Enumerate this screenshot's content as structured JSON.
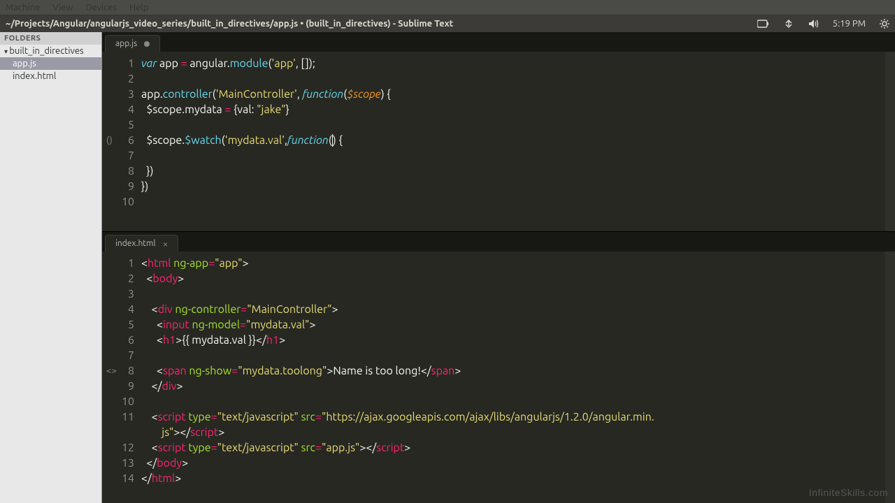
{
  "os_menu": {
    "items": [
      "Machine",
      "View",
      "Devices",
      "Help"
    ]
  },
  "panel": {
    "title": "~/Projects/Angular/angularjs_video_series/built_in_directives/app.js • (built_in_directives) - Sublime Text",
    "time": "5:19 PM"
  },
  "sidebar": {
    "header": "FOLDERS",
    "root": "built_in_directives",
    "files": [
      "app.js",
      "index.html"
    ],
    "selected": "app.js"
  },
  "tabs_top": {
    "label": "app.js",
    "dirty": true
  },
  "tabs_bottom": {
    "label": "index.html",
    "dirty": false
  },
  "code_top": {
    "lines": [
      {
        "n": 1,
        "tokens": [
          [
            "kw2",
            "var"
          ],
          [
            "punc",
            " "
          ],
          [
            "punc",
            "app "
          ],
          [
            "op",
            "="
          ],
          [
            "punc",
            " angular."
          ],
          [
            "fncall",
            "module"
          ],
          [
            "punc",
            "("
          ],
          [
            "str",
            "'app'"
          ],
          [
            "punc",
            ", []);"
          ]
        ]
      },
      {
        "n": 2,
        "tokens": []
      },
      {
        "n": 3,
        "tokens": [
          [
            "punc",
            "app."
          ],
          [
            "fncall",
            "controller"
          ],
          [
            "punc",
            "("
          ],
          [
            "str",
            "'MainController'"
          ],
          [
            "punc",
            ", "
          ],
          [
            "kw2",
            "function"
          ],
          [
            "punc",
            "("
          ],
          [
            "param",
            "$scope"
          ],
          [
            "punc",
            ") {"
          ]
        ]
      },
      {
        "n": 4,
        "tokens": [
          [
            "punc",
            "  $scope.mydata "
          ],
          [
            "op",
            "="
          ],
          [
            "punc",
            " {val: "
          ],
          [
            "str",
            "\"jake\""
          ],
          [
            "punc",
            "}"
          ]
        ]
      },
      {
        "n": 5,
        "tokens": []
      },
      {
        "n": 6,
        "mark": "()",
        "tokens": [
          [
            "punc",
            "  $scope."
          ],
          [
            "fncall",
            "$watch"
          ],
          [
            "punc",
            "("
          ],
          [
            "str",
            "'mydata.val'"
          ],
          [
            "punc",
            ","
          ],
          [
            "kw2",
            "function"
          ],
          [
            "punc",
            "(|) {"
          ]
        ]
      },
      {
        "n": 7,
        "tokens": []
      },
      {
        "n": 8,
        "tokens": [
          [
            "punc",
            "  })"
          ]
        ]
      },
      {
        "n": 9,
        "tokens": [
          [
            "punc",
            "})"
          ]
        ]
      },
      {
        "n": 10,
        "tokens": []
      }
    ]
  },
  "code_bottom": {
    "lines": [
      {
        "n": 1,
        "tokens": [
          [
            "lt",
            "<"
          ],
          [
            "tag",
            "html "
          ],
          [
            "attr",
            "ng-app"
          ],
          [
            "op",
            "="
          ],
          [
            "str",
            "\"app\""
          ],
          [
            "lt",
            ">"
          ]
        ]
      },
      {
        "n": 2,
        "tokens": [
          [
            "punc",
            "  "
          ],
          [
            "lt",
            "<"
          ],
          [
            "tag",
            "body"
          ],
          [
            "lt",
            ">"
          ]
        ]
      },
      {
        "n": 3,
        "tokens": []
      },
      {
        "n": 4,
        "tokens": [
          [
            "punc",
            "    "
          ],
          [
            "lt",
            "<"
          ],
          [
            "tag",
            "div "
          ],
          [
            "attr",
            "ng-controller"
          ],
          [
            "op",
            "="
          ],
          [
            "str",
            "\"MainController\""
          ],
          [
            "lt",
            ">"
          ]
        ]
      },
      {
        "n": 5,
        "tokens": [
          [
            "punc",
            "      "
          ],
          [
            "lt",
            "<"
          ],
          [
            "tag",
            "input "
          ],
          [
            "attr",
            "ng-model"
          ],
          [
            "op",
            "="
          ],
          [
            "str",
            "\"mydata.val\""
          ],
          [
            "lt",
            ">"
          ]
        ]
      },
      {
        "n": 6,
        "tokens": [
          [
            "punc",
            "      "
          ],
          [
            "lt",
            "<"
          ],
          [
            "tag",
            "h1"
          ],
          [
            "lt",
            ">"
          ],
          [
            "punc",
            "{{ mydata.val }}"
          ],
          [
            "lt",
            "</"
          ],
          [
            "tag",
            "h1"
          ],
          [
            "lt",
            ">"
          ]
        ]
      },
      {
        "n": 7,
        "tokens": []
      },
      {
        "n": 8,
        "mark": "<>",
        "tokens": [
          [
            "punc",
            "      "
          ],
          [
            "lt",
            "<"
          ],
          [
            "tag",
            "span "
          ],
          [
            "attr",
            "ng-show"
          ],
          [
            "op",
            "="
          ],
          [
            "str",
            "\"mydata.toolong\""
          ],
          [
            "lt",
            ">"
          ],
          [
            "punc",
            "Name is too long!"
          ],
          [
            "lt",
            "</"
          ],
          [
            "tag",
            "span"
          ],
          [
            "lt",
            ">"
          ]
        ]
      },
      {
        "n": 9,
        "tokens": [
          [
            "punc",
            "    "
          ],
          [
            "lt",
            "</"
          ],
          [
            "tag",
            "div"
          ],
          [
            "lt",
            ">"
          ]
        ]
      },
      {
        "n": 10,
        "tokens": []
      },
      {
        "n": 11,
        "tokens": [
          [
            "punc",
            "    "
          ],
          [
            "lt",
            "<"
          ],
          [
            "tag",
            "script "
          ],
          [
            "attr",
            "type"
          ],
          [
            "op",
            "="
          ],
          [
            "str",
            "\"text/javascript\""
          ],
          [
            "punc",
            " "
          ],
          [
            "attr",
            "src"
          ],
          [
            "op",
            "="
          ],
          [
            "str",
            "\"https://ajax.googleapis.com/ajax/libs/angularjs/1.2.0/angular.min."
          ]
        ]
      },
      {
        "n": "",
        "tokens": [
          [
            "str",
            "        js\""
          ],
          [
            "lt",
            "></"
          ],
          [
            "tag",
            "script"
          ],
          [
            "lt",
            ">"
          ]
        ]
      },
      {
        "n": 12,
        "tokens": [
          [
            "punc",
            "    "
          ],
          [
            "lt",
            "<"
          ],
          [
            "tag",
            "script "
          ],
          [
            "attr",
            "type"
          ],
          [
            "op",
            "="
          ],
          [
            "str",
            "\"text/javascript\""
          ],
          [
            "punc",
            " "
          ],
          [
            "attr",
            "src"
          ],
          [
            "op",
            "="
          ],
          [
            "str",
            "\"app.js\""
          ],
          [
            "lt",
            "></"
          ],
          [
            "tag",
            "script"
          ],
          [
            "lt",
            ">"
          ]
        ]
      },
      {
        "n": 13,
        "tokens": [
          [
            "punc",
            "  "
          ],
          [
            "lt",
            "</"
          ],
          [
            "tag",
            "body"
          ],
          [
            "lt",
            ">"
          ]
        ]
      },
      {
        "n": 14,
        "tokens": [
          [
            "lt",
            "</"
          ],
          [
            "tag",
            "html"
          ],
          [
            "lt",
            ">"
          ]
        ]
      }
    ]
  },
  "watermark": "InfiniteSkills.com"
}
